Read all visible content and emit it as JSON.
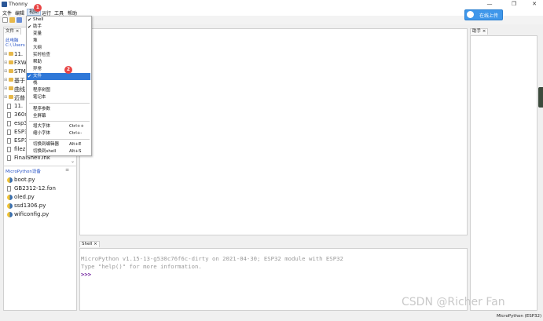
{
  "window": {
    "title": "Thonny",
    "controls": [
      "—",
      "❐",
      "✕"
    ]
  },
  "menubar": [
    "文件",
    "编辑",
    "视图",
    "运行",
    "工具",
    "帮助"
  ],
  "upload_button": {
    "label": "在线上传"
  },
  "files": {
    "tab": "文件 ×",
    "local_title": "此电脑",
    "local_path": "C:\\ Users",
    "local_items": [
      "11.",
      "FXW",
      "STM",
      "基于",
      "曲线",
      "迈普",
      "11.",
      "360s",
      "esp3",
      "ESP3",
      "ESP3",
      "filezi",
      "FinalShell.lnk"
    ],
    "device_title": "MicroPython设备",
    "device_items": [
      "boot.py",
      "GB2312-12.fon",
      "oled.py",
      "ssd1306.py",
      "wificonfig.py"
    ]
  },
  "assistant": {
    "tab": "助手 ×"
  },
  "shell": {
    "tab": "Shell ×",
    "lines": [
      "MicroPython v1.15-13-g530c76f6c-dirty on 2021-04-30; ESP32 module with ESP32",
      "Type \"help()\" for more information."
    ],
    "prompt": ">>>"
  },
  "view_menu": {
    "items": [
      {
        "label": "Shell",
        "checked": true
      },
      {
        "label": "助手",
        "checked": true
      },
      {
        "label": "变量",
        "checked": false
      },
      {
        "label": "堆",
        "checked": false
      },
      {
        "label": "大纲",
        "checked": false
      },
      {
        "label": "实时检查",
        "checked": false
      },
      {
        "label": "帮助",
        "checked": false
      },
      {
        "label": "异常",
        "checked": false
      },
      {
        "label": "文件",
        "checked": true
      },
      {
        "label": "栈",
        "checked": false
      },
      {
        "label": "程序树图",
        "checked": false
      },
      {
        "label": "笔记本",
        "checked": false
      },
      {
        "label": "程序参数",
        "checked": false
      },
      {
        "label": "全屏幕",
        "checked": false
      },
      {
        "label": "增大字体",
        "shortcut": "Ctrl++"
      },
      {
        "label": "缩小字体",
        "shortcut": "Ctrl+-"
      },
      {
        "label": "切换到编辑器",
        "shortcut": "Alt+E"
      },
      {
        "label": "切换到shell",
        "shortcut": "Alt+S"
      }
    ]
  },
  "badges": [
    "1",
    "2"
  ],
  "status": {
    "text": "MicroPython (ESP32)"
  },
  "watermark": "CSDN @Richer Fan",
  "colors": {
    "accent": "#2f78d8",
    "upload": "#3f97ea",
    "badge": "#e84545",
    "prompt": "#6c1b9b"
  }
}
